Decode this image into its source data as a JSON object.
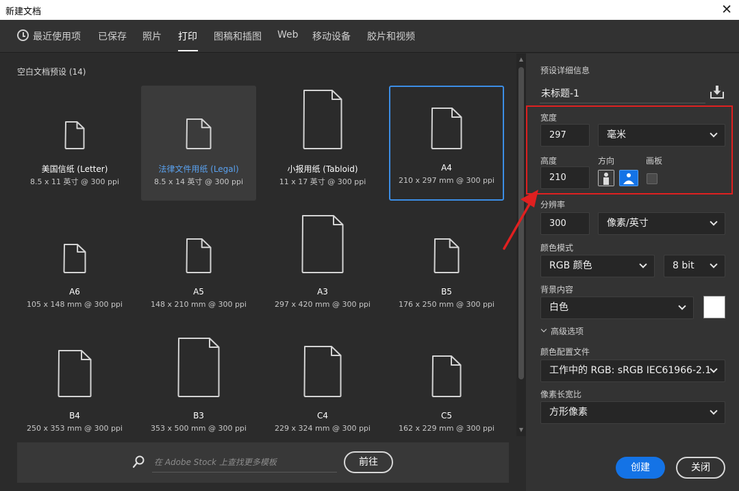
{
  "window": {
    "title": "新建文档"
  },
  "tabs": [
    {
      "label": "最近使用项",
      "icon": "clock-icon"
    },
    {
      "label": "已保存"
    },
    {
      "label": "照片"
    },
    {
      "label": "打印",
      "active": true
    },
    {
      "label": "图稿和插图"
    },
    {
      "label": "Web"
    },
    {
      "label": "移动设备"
    },
    {
      "label": "胶片和视频"
    }
  ],
  "presets": {
    "heading": "空白文档预设",
    "count": "(14)",
    "items": [
      {
        "name": "美国信纸 (Letter)",
        "size": "8.5 x 11 英寸 @ 300 ppi",
        "state": "normal"
      },
      {
        "name": "法律文件用纸 (Legal)",
        "size": "8.5 x 14 英寸 @ 300 ppi",
        "state": "hover"
      },
      {
        "name": "小报用纸 (Tabloid)",
        "size": "11 x 17 英寸 @ 300 ppi",
        "state": "normal"
      },
      {
        "name": "A4",
        "size": "210 x 297 mm @ 300 ppi",
        "state": "selected"
      },
      {
        "name": "A6",
        "size": "105 x 148 mm @ 300 ppi",
        "state": "normal"
      },
      {
        "name": "A5",
        "size": "148 x 210 mm @ 300 ppi",
        "state": "normal"
      },
      {
        "name": "A3",
        "size": "297 x 420 mm @ 300 ppi",
        "state": "normal"
      },
      {
        "name": "B5",
        "size": "176 x 250 mm @ 300 ppi",
        "state": "normal"
      },
      {
        "name": "B4",
        "size": "250 x 353 mm @ 300 ppi",
        "state": "normal"
      },
      {
        "name": "B3",
        "size": "353 x 500 mm @ 300 ppi",
        "state": "normal"
      },
      {
        "name": "C4",
        "size": "229 x 324 mm @ 300 ppi",
        "state": "normal"
      },
      {
        "name": "C5",
        "size": "162 x 229 mm @ 300 ppi",
        "state": "normal"
      }
    ]
  },
  "stock": {
    "placeholder": "在 Adobe Stock 上查找更多模板",
    "go_label": "前往"
  },
  "details": {
    "heading": "预设详细信息",
    "doc_name": "未标题-1",
    "width_label": "宽度",
    "width_value": "297",
    "width_unit": "毫米",
    "height_label": "高度",
    "height_value": "210",
    "orientation_label": "方向",
    "artboard_label": "画板",
    "resolution_label": "分辨率",
    "resolution_value": "300",
    "resolution_unit": "像素/英寸",
    "color_mode_label": "颜色模式",
    "color_mode_value": "RGB 颜色",
    "bit_depth_value": "8 bit",
    "background_label": "背景内容",
    "background_value": "白色",
    "background_color": "#ffffff",
    "advanced_label": "高级选项",
    "color_profile_label": "颜色配置文件",
    "color_profile_value": "工作中的 RGB: sRGB IEC61966-2.1",
    "pixel_aspect_label": "像素长宽比",
    "pixel_aspect_value": "方形像素",
    "create_label": "创建",
    "close_label": "关闭"
  },
  "colors": {
    "accent": "#1473e6",
    "selection_border": "#3c8ee6",
    "annotation": "#e02020"
  }
}
